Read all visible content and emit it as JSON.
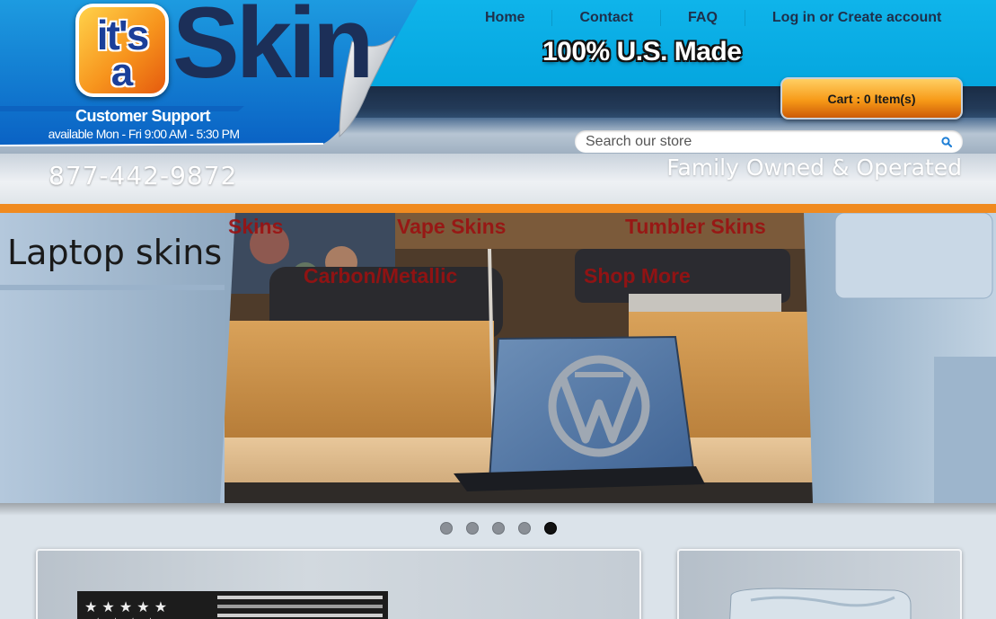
{
  "header": {
    "logo": {
      "badge_line1": "it's",
      "badge_line2": "a",
      "wordmark": "Skin"
    },
    "support": {
      "title": "Customer Support",
      "hours": "available Mon - Fri 9:00 AM - 5:30 PM",
      "phone": "877-442-9872"
    },
    "nav": [
      {
        "label": "Home"
      },
      {
        "label": "Contact"
      },
      {
        "label": "FAQ"
      },
      {
        "label": "Log in or Create account"
      }
    ],
    "tagline": "100% U.S. Made",
    "cart_label": "Cart : 0 Item(s)",
    "search": {
      "placeholder": "Search our store",
      "value": ""
    },
    "family_text": "Family Owned & Operated"
  },
  "slider": {
    "title": "Laptop skins",
    "category_links": [
      {
        "label": "Skins"
      },
      {
        "label": "Vape Skins"
      },
      {
        "label": "Tumbler Skins"
      },
      {
        "label": "Carbon/Metallic"
      },
      {
        "label": "Shop More"
      }
    ],
    "dots_total": 5,
    "active_dot": 5
  },
  "colors": {
    "brand_blue": "#05a6df",
    "navy": "#1c2f58",
    "accent_orange": "#f08a1f",
    "link_red": "#9b1111"
  },
  "icons": [
    "search-icon"
  ]
}
